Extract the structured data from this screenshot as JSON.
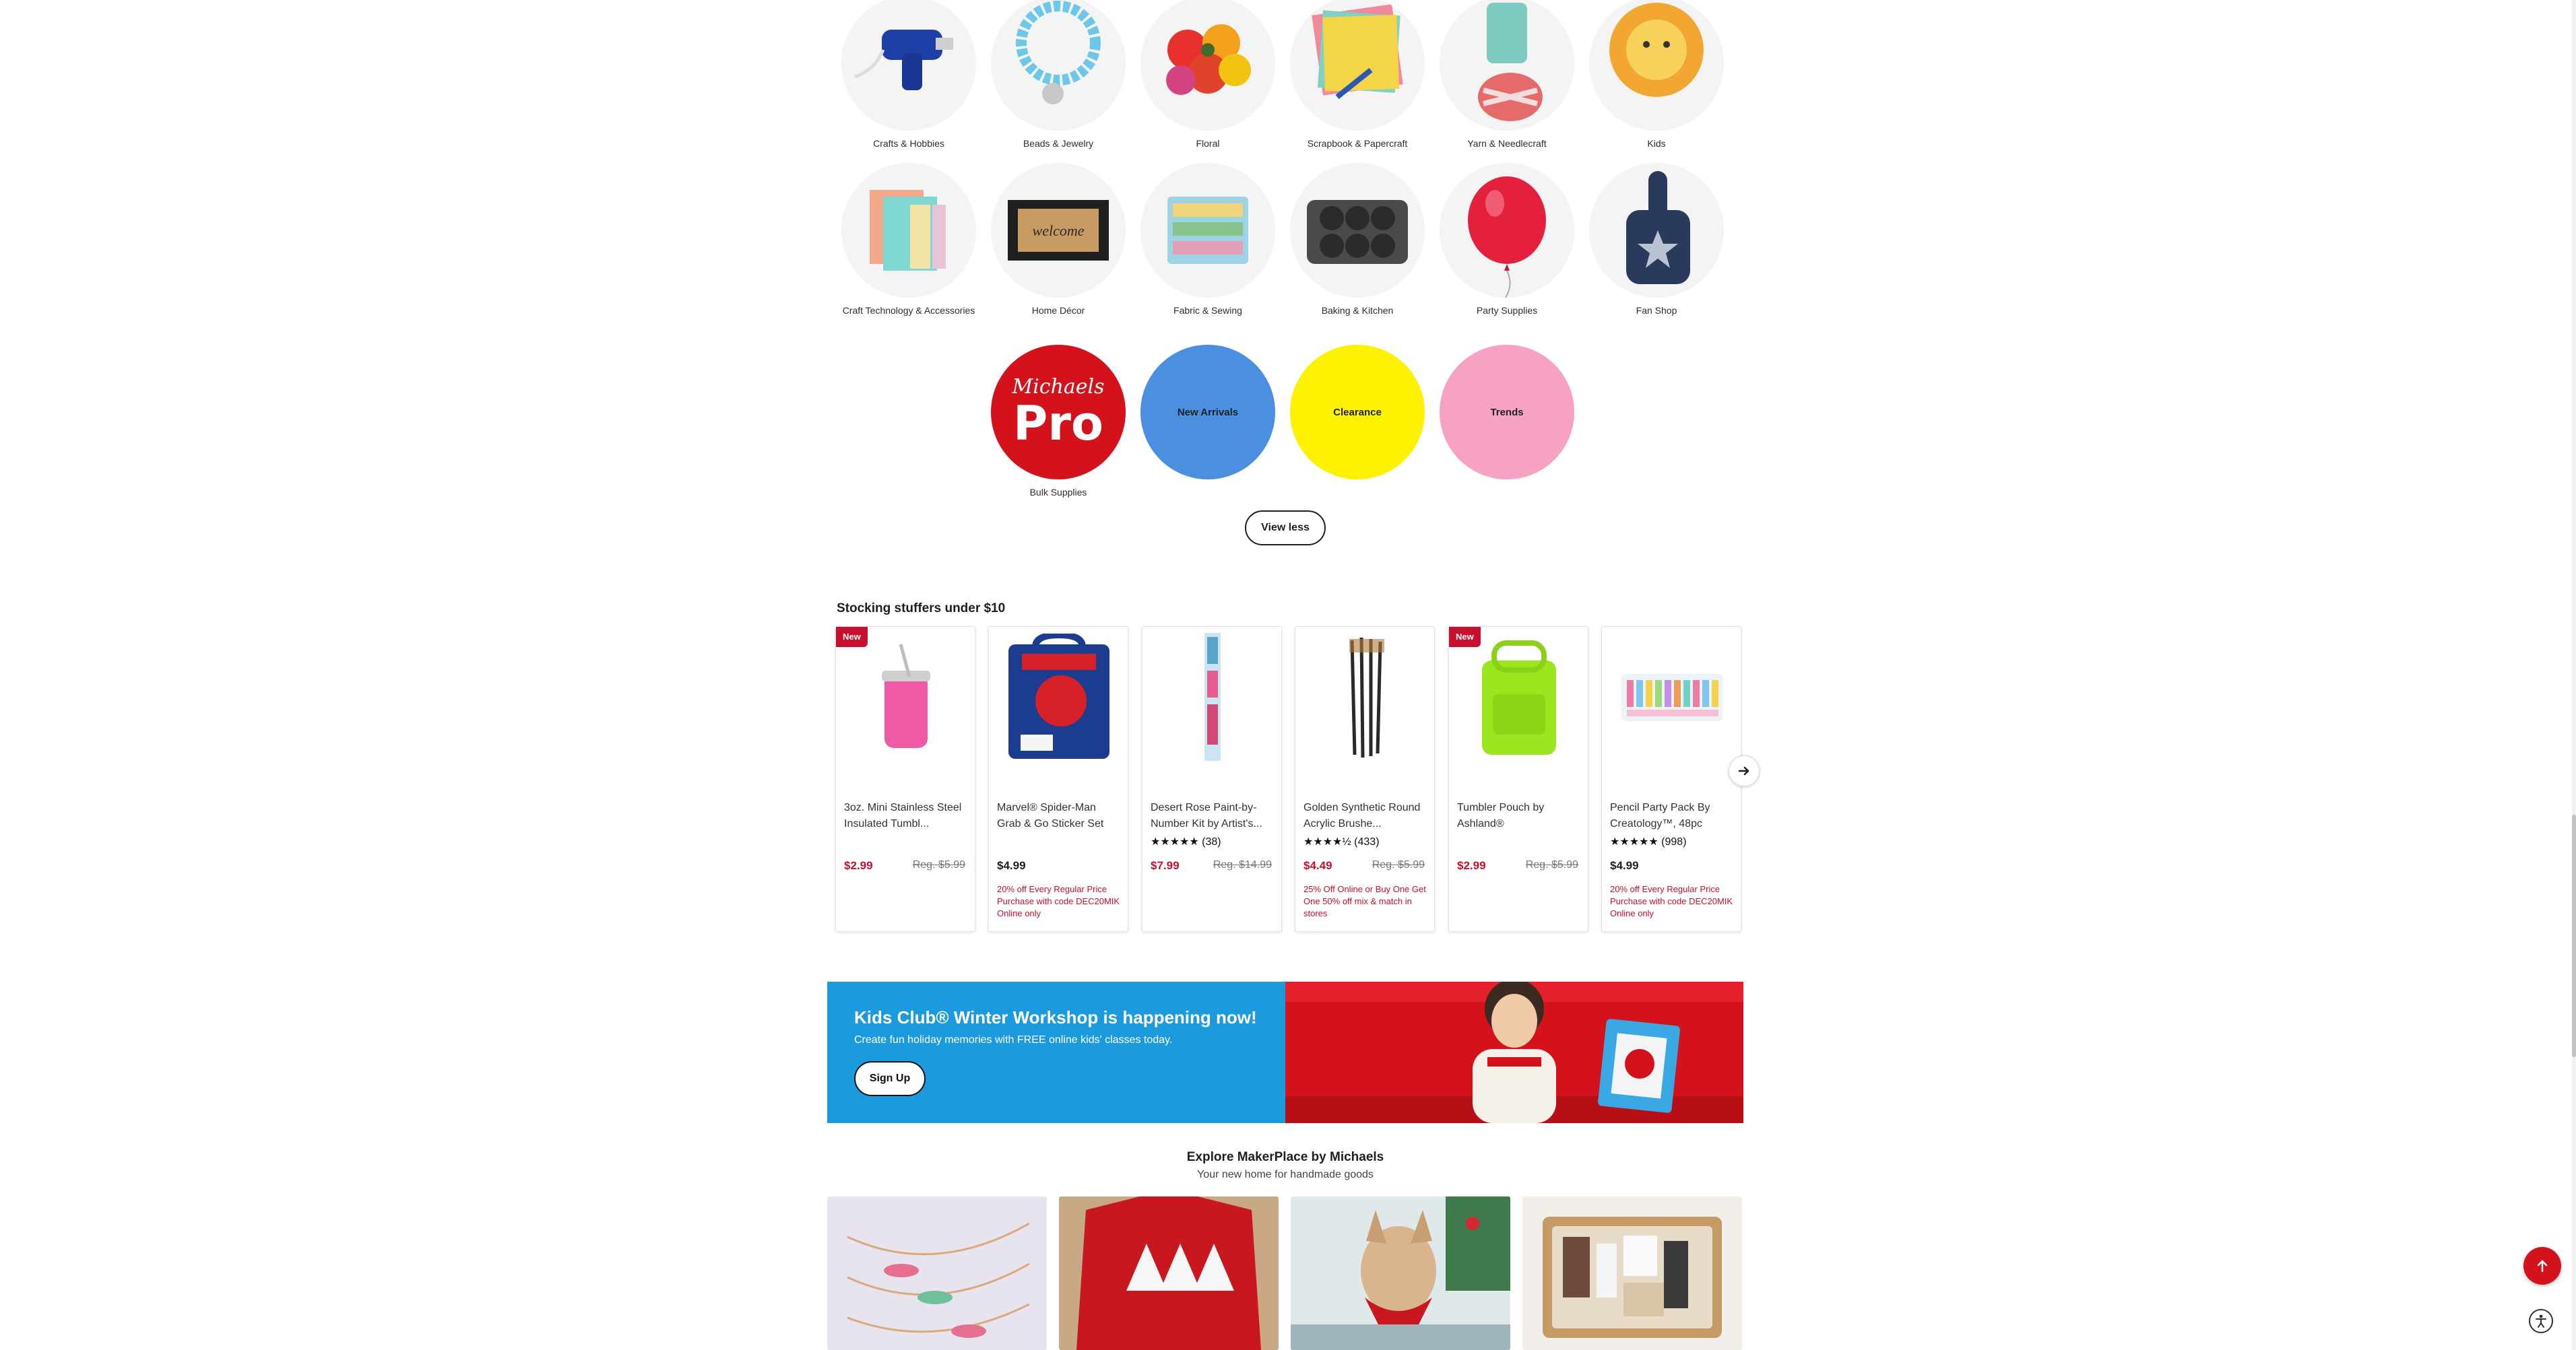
{
  "categories": {
    "row1": [
      {
        "label": "Crafts & Hobbies",
        "icon": "glue-gun-icon"
      },
      {
        "label": "Beads & Jewelry",
        "icon": "bracelet-icon"
      },
      {
        "label": "Floral",
        "icon": "flower-bouquet-icon"
      },
      {
        "label": "Scrapbook & Papercraft",
        "icon": "paper-stack-icon"
      },
      {
        "label": "Yarn & Needlecraft",
        "icon": "yarn-spool-icon"
      },
      {
        "label": "Kids",
        "icon": "paper-lion-icon"
      }
    ],
    "row2": [
      {
        "label": "Craft Technology & Accessories",
        "icon": "vinyl-sheets-icon"
      },
      {
        "label": "Home Décor",
        "icon": "welcome-mat-icon"
      },
      {
        "label": "Fabric & Sewing",
        "icon": "fabric-bundle-icon"
      },
      {
        "label": "Baking & Kitchen",
        "icon": "muffin-pan-icon"
      },
      {
        "label": "Party Supplies",
        "icon": "balloon-icon"
      },
      {
        "label": "Fan Shop",
        "icon": "foam-finger-icon"
      }
    ],
    "row3": [
      {
        "label": "Bulk Supplies",
        "logo_line1": "Michaels",
        "logo_line2": "Pro",
        "color": "#d4121b"
      },
      {
        "label": "New Arrivals",
        "color": "#4a8fe0"
      },
      {
        "label": "Clearance",
        "color": "#fff200"
      },
      {
        "label": "Trends",
        "color": "#f7a1c4"
      }
    ],
    "view_less_label": "View less"
  },
  "stocking": {
    "title": "Stocking stuffers under $10",
    "products": [
      {
        "badge": "New",
        "title": "3oz. Mini Stainless Steel Insulated Tumbl...",
        "price": "$2.99",
        "reg": "Reg. $5.99",
        "sale": true,
        "image": "pink-tumbler-image"
      },
      {
        "title": "Marvel® Spider-Man Grab & Go Sticker Set",
        "price": "$4.99",
        "promo": "20% off Every Regular Price Purchase with code DEC20MIK Online only",
        "image": "spiderman-sticker-set-image"
      },
      {
        "title": "Desert Rose Paint-by-Number Kit by Artist's...",
        "stars": "★★★★★",
        "rating_count": "(38)",
        "price": "$7.99",
        "reg": "Reg. $14.99",
        "sale": true,
        "image": "paint-by-number-kit-image"
      },
      {
        "title": "Golden Synthetic Round Acrylic Brushe...",
        "stars": "★★★★½",
        "rating_count": "(433)",
        "price": "$4.49",
        "reg": "Reg. $5.99",
        "sale": true,
        "promo": "25% Off Online or Buy One Get One 50% off mix & match in stores",
        "image": "paint-brushes-image"
      },
      {
        "badge": "New",
        "title": "Tumbler Pouch by Ashland®",
        "price": "$2.99",
        "reg": "Reg. $5.99",
        "sale": true,
        "image": "green-pouch-image"
      },
      {
        "title": "Pencil Party Pack By Creatology™, 48pc",
        "stars": "★★★★★",
        "rating_count": "(998)",
        "price": "$4.99",
        "promo": "20% off Every Regular Price Purchase with code DEC20MIK Online only",
        "image": "pencil-pack-image"
      }
    ],
    "next_icon": "arrow-right-icon"
  },
  "banner": {
    "title": "Kids Club® Winter Workshop is happening now!",
    "subtitle": "Create fun holiday memories with FREE online kids' classes today.",
    "button": "Sign Up",
    "left_color": "#1c9ade",
    "right_color": "#d4121b"
  },
  "makerplace": {
    "title": "Explore MakerPlace by Michaels",
    "subtitle": "Your new home for handmade goods",
    "tiles": [
      "name-necklace-image",
      "christmas-tree-shirt-image",
      "dog-with-bandana-image",
      "gift-basket-image"
    ]
  },
  "floating": {
    "back_to_top_icon": "arrow-up-icon",
    "accessibility_icon": "accessibility-icon"
  }
}
